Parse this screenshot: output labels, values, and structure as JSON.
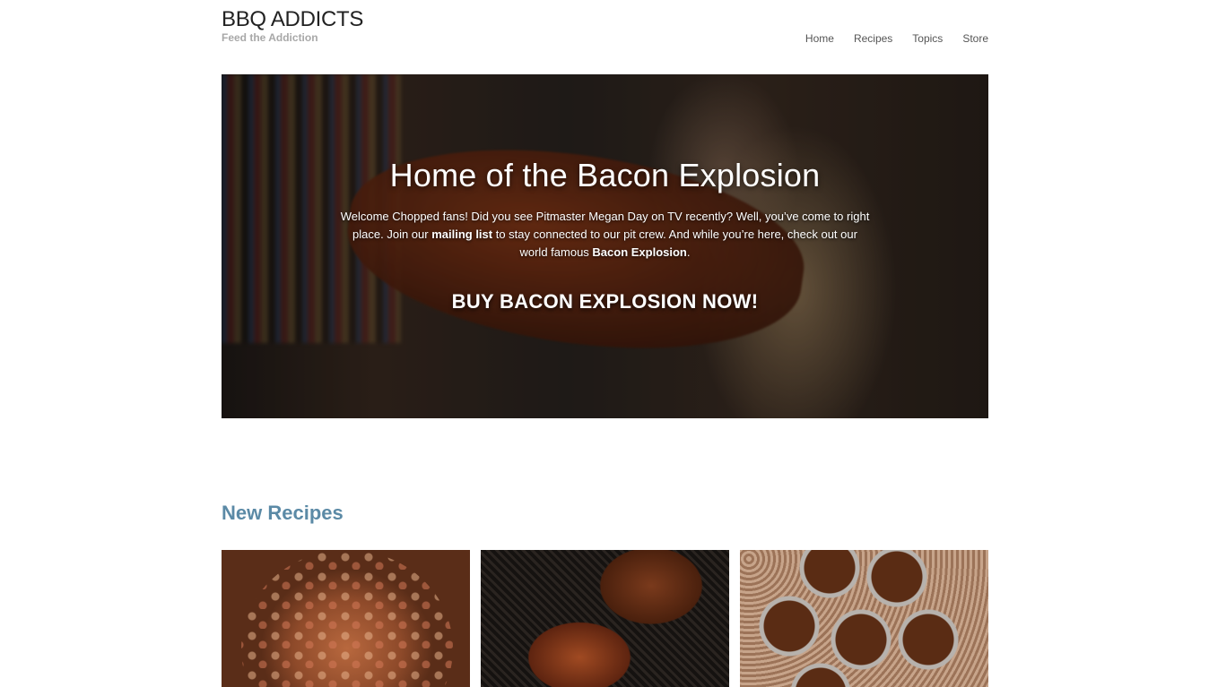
{
  "header": {
    "site_title": "BBQ ADDICTS",
    "tagline": "Feed the Addiction",
    "nav": [
      {
        "label": "Home"
      },
      {
        "label": "Recipes"
      },
      {
        "label": "Topics"
      },
      {
        "label": "Store"
      }
    ]
  },
  "hero": {
    "title": "Home of the Bacon Explosion",
    "text_part1": "Welcome Chopped fans! Did you see Pitmaster Megan Day on TV recently? Well, you’ve come to right place. Join our ",
    "link_mailing_list": "mailing list",
    "text_part2": " to stay connected to our pit crew. And while you’re here, check out our world famous ",
    "link_bacon_explosion": "Bacon Explosion",
    "text_part3": ".",
    "cta": "BUY BACON EXPLOSION NOW!"
  },
  "recipes": {
    "section_title": "New Recipes"
  },
  "colors": {
    "section_title": "#5b8aa6",
    "tagline": "#a8a8a8"
  }
}
